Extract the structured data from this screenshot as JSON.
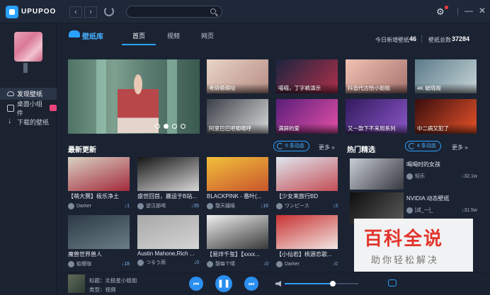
{
  "app": {
    "brand": "UPUPOO"
  },
  "titlebar": {
    "back": "‹",
    "forward": "›",
    "search_placeholder": "",
    "minimize": "—",
    "close": "✕"
  },
  "sidebar": {
    "items": [
      {
        "label": "发现壁纸",
        "active": true
      },
      {
        "label": "桌面小组件"
      },
      {
        "label": "下载的壁纸"
      }
    ]
  },
  "header": {
    "library_title": "壁纸库",
    "tabs": [
      {
        "label": "首页",
        "active": true
      },
      {
        "label": "视频"
      },
      {
        "label": "网页"
      }
    ],
    "stats": {
      "today_label": "今日新增壁纸",
      "today_value": "46",
      "total_label": "壁纸总数",
      "total_value": "37284"
    }
  },
  "featured": [
    {
      "caption": "考研萌萌哒",
      "c1": "#e8d4c8",
      "c2": "#b88e84"
    },
    {
      "caption": "喵喵，丁字裤演示",
      "c1": "#1c2440",
      "c2": "#b0304a"
    },
    {
      "caption": "抖音代古怡小姐姐",
      "c1": "#f0c2b3",
      "c2": "#a7736e"
    },
    {
      "caption": "4K 破晓阁",
      "c1": "#5b7a89",
      "c2": "#c8d6d8"
    },
    {
      "caption": "阿里巴巴吧唧唧呼",
      "c1": "#3a3f47",
      "c2": "#d9d9d9"
    },
    {
      "caption": "满屏的爱",
      "c1": "#5a1e7a",
      "c2": "#e34fa6"
    },
    {
      "caption": "又一款下不来用系列",
      "c1": "#321a5e",
      "c2": "#8a56c8"
    },
    {
      "caption": "中二病又犯了",
      "c1": "#3a0d0d",
      "c2": "#e8532a"
    }
  ],
  "latest": {
    "title": "最新更新",
    "refresh_label": "6 条动态",
    "more_label": "更多 »",
    "cards": [
      {
        "title": "【萌大赛】极乐净土",
        "author": "Darker",
        "downloads": "↓1",
        "c1": "#d9d2c4",
        "c2": "#a3293a"
      },
      {
        "title": "盛世回首，搬运于B站...",
        "author": "逆汉部喝",
        "downloads": "↓35",
        "c1": "#151515",
        "c2": "#d7d7d7"
      },
      {
        "title": "BLACKPINK - 番叶(...",
        "author": "憩天缱绻",
        "downloads": "↓16",
        "c1": "#f2c03b",
        "c2": "#c8552c"
      },
      {
        "title": "【少女来旅行BD",
        "author": "ワンピース",
        "downloads": "↓3",
        "c1": "#dfe6ef",
        "c2": "#c44d55"
      },
      {
        "title": "魔兽世界兽人",
        "author": "蛤蟆咖",
        "downloads": "↓18",
        "c1": "#2c3a46",
        "c2": "#6a7d86"
      },
      {
        "title": "Austin Mahone,Rich ...",
        "author": "つるう雨",
        "downloads": "↓0",
        "c1": "#a8a8a8",
        "c2": "#d4d4d4"
      },
      {
        "title": "【易烊千玺】【xxxx...",
        "author": "憩每个晴",
        "downloads": "↓0",
        "c1": "#f0f0f0",
        "c2": "#383838"
      },
      {
        "title": "【小仙若】桃源恋歌...",
        "author": "Darker",
        "downloads": "↓0",
        "c1": "#c83232",
        "c2": "#f1e6e2"
      }
    ]
  },
  "hot": {
    "title": "热门精选",
    "refresh_label": "4 条动态",
    "more_label": "更多 »",
    "items": [
      {
        "title": "喝喝时的女孩",
        "author": "轻乐",
        "downloads": "32.1w",
        "c1": "#c8cdd4",
        "c2": "#37373f"
      },
      {
        "title": "NVIDIA 动态壁纸",
        "author": "[成_一]_",
        "downloads": "31.5w",
        "c1": "#0e0e0e",
        "c2": "#5a5a5a"
      }
    ]
  },
  "watermark": {
    "title": "百科全说",
    "subtitle": "助你轻松解决"
  },
  "player": {
    "title_line": "标题：北极星小姐姐",
    "type_line": "类型：视频",
    "prev": "⏮",
    "pause": "❚❚",
    "next": "⏭",
    "volume": 0.65
  },
  "colors": {
    "accent": "#2aa1ff",
    "bg": "#1b2333"
  }
}
